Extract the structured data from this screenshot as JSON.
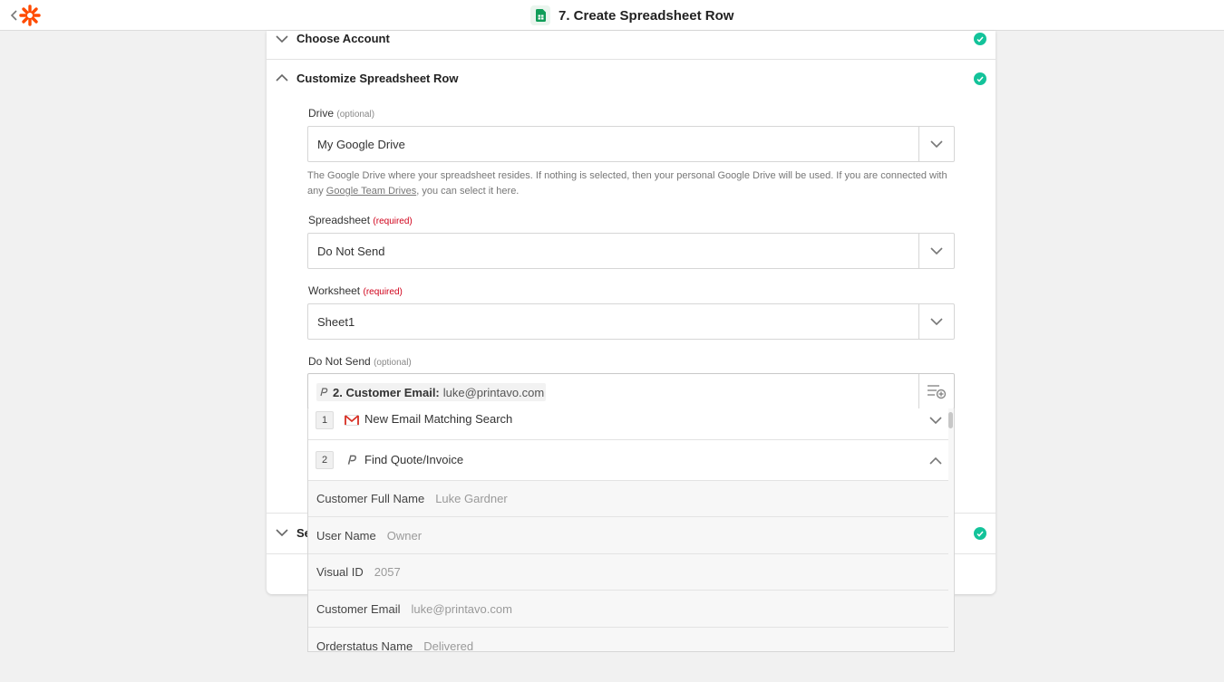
{
  "header": {
    "title": "7. Create Spreadsheet Row"
  },
  "sections": {
    "choose_account": "Choose Account",
    "customize_row": "Customize Spreadsheet Row",
    "bottom_partial": "Se"
  },
  "fields": {
    "drive": {
      "label": "Drive",
      "tag": "(optional)",
      "value": "My Google Drive",
      "help_before": "The Google Drive where your spreadsheet resides. If nothing is selected, then your personal Google Drive will be used. If you are connected with any ",
      "help_link": "Google Team Drives",
      "help_after": ", you can select it here."
    },
    "spreadsheet": {
      "label": "Spreadsheet",
      "tag": "(required)",
      "value": "Do Not Send"
    },
    "worksheet": {
      "label": "Worksheet",
      "tag": "(required)",
      "value": "Sheet1"
    },
    "do_not_send": {
      "label": "Do Not Send",
      "tag": "(optional)",
      "pill_label": "2. Customer Email:",
      "pill_value": "luke@printavo.com"
    }
  },
  "dropdown": {
    "steps": [
      {
        "num": "1",
        "label": "New Email Matching Search",
        "icon": "gmail-icon"
      },
      {
        "num": "2",
        "label": "Find Quote/Invoice",
        "icon": "printavo-icon"
      }
    ],
    "rows": [
      {
        "key": "Customer Full Name",
        "value": "Luke Gardner"
      },
      {
        "key": "User Name",
        "value": "Owner"
      },
      {
        "key": "Visual ID",
        "value": "2057"
      },
      {
        "key": "Customer Email",
        "value": "luke@printavo.com"
      },
      {
        "key": "Orderstatus Name",
        "value": "Delivered"
      }
    ]
  },
  "colors": {
    "brand": "#ff4a00",
    "check": "#13c39a",
    "required": "#d0021b",
    "sheets": "#0f9d58"
  }
}
